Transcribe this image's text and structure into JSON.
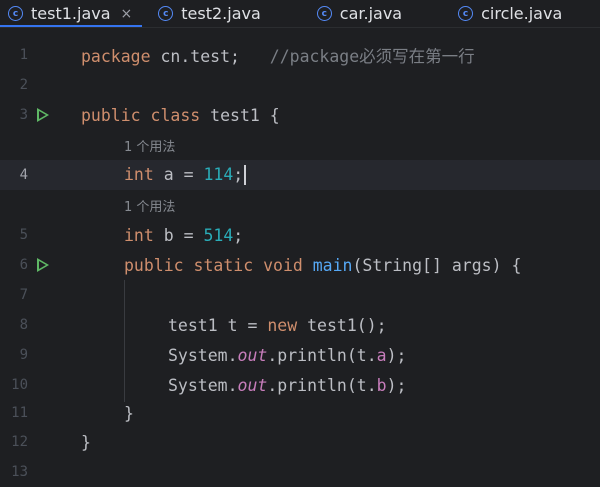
{
  "tabs": [
    {
      "label": "test1.java",
      "active": true,
      "close": "×"
    },
    {
      "label": "test2.java",
      "active": false
    },
    {
      "label": "car.java",
      "active": false
    },
    {
      "label": "circle.java",
      "active": false
    }
  ],
  "icon": {
    "class_icon_letter": "c"
  },
  "colors": {
    "accent": "#3574f0",
    "keyword": "#cf8e6d",
    "number": "#2aacb8",
    "function": "#56a8f5",
    "static_field": "#c77dbb",
    "comment": "#7a7e85",
    "run": "#5fb865"
  },
  "line_numbers": [
    "1",
    "2",
    "3",
    "4",
    "5",
    "6",
    "7",
    "8",
    "9",
    "10",
    "11",
    "12",
    "13"
  ],
  "current_line": "4",
  "code": {
    "l1_kw": "package",
    "l1_rest": " cn.test;   ",
    "l1_comment": "//package必须写在第一行",
    "l3_kw": "public class",
    "l3_rest": " test1 {",
    "hint1": "1 个用法",
    "l4_kw": "int",
    "l4_mid": " a = ",
    "l4_num": "114",
    "l4_end": ";",
    "hint2": "1 个用法",
    "l5_kw": "int",
    "l5_mid": " b = ",
    "l5_num": "514",
    "l5_end": ";",
    "l6_kw": "public static void",
    "l6_sp": " ",
    "l6_fn": "main",
    "l6_rest": "(String[] args) {",
    "l8_a": "test1 t = ",
    "l8_kw": "new",
    "l8_b": " test1();",
    "l9_a": "System.",
    "l9_st": "out",
    "l9_b": ".println(t.",
    "l9_f": "a",
    "l9_c": ");",
    "l10_a": "System.",
    "l10_st": "out",
    "l10_b": ".println(t.",
    "l10_f": "b",
    "l10_c": ");",
    "l11": "}",
    "l12": "}"
  }
}
